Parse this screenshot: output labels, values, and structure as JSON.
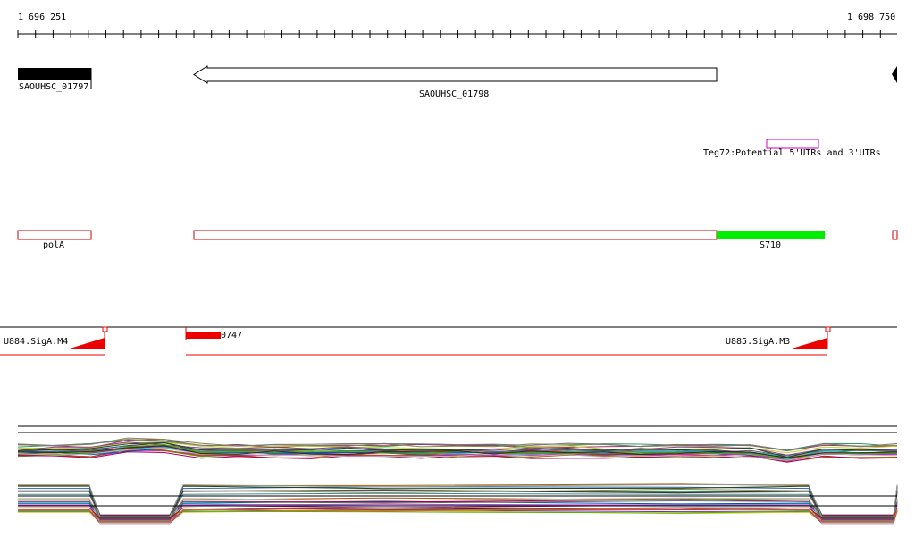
{
  "ruler": {
    "start_label": "1 696 251",
    "end_label": "1 698 750"
  },
  "genes": {
    "gene1_label": "SAOUHSC_01797",
    "gene2_label": "SAOUHSC_01798"
  },
  "annotations": {
    "teg_label": "Teg72:Potential 5'UTRs and 3'UTRs"
  },
  "regions": {
    "pola_label": "polA",
    "s710_label": "S710"
  },
  "promoters": {
    "u884_label": "U884.SigA.M4",
    "u885_label": "U885.SigA.M3",
    "feature_0747_label": "0747"
  },
  "colors": {
    "gene_fill": "#000000",
    "teg_outline": "#cc00cc",
    "region_outline": "#cc0000",
    "s710_fill": "#00ee00",
    "promoter_red": "#ee0000"
  }
}
